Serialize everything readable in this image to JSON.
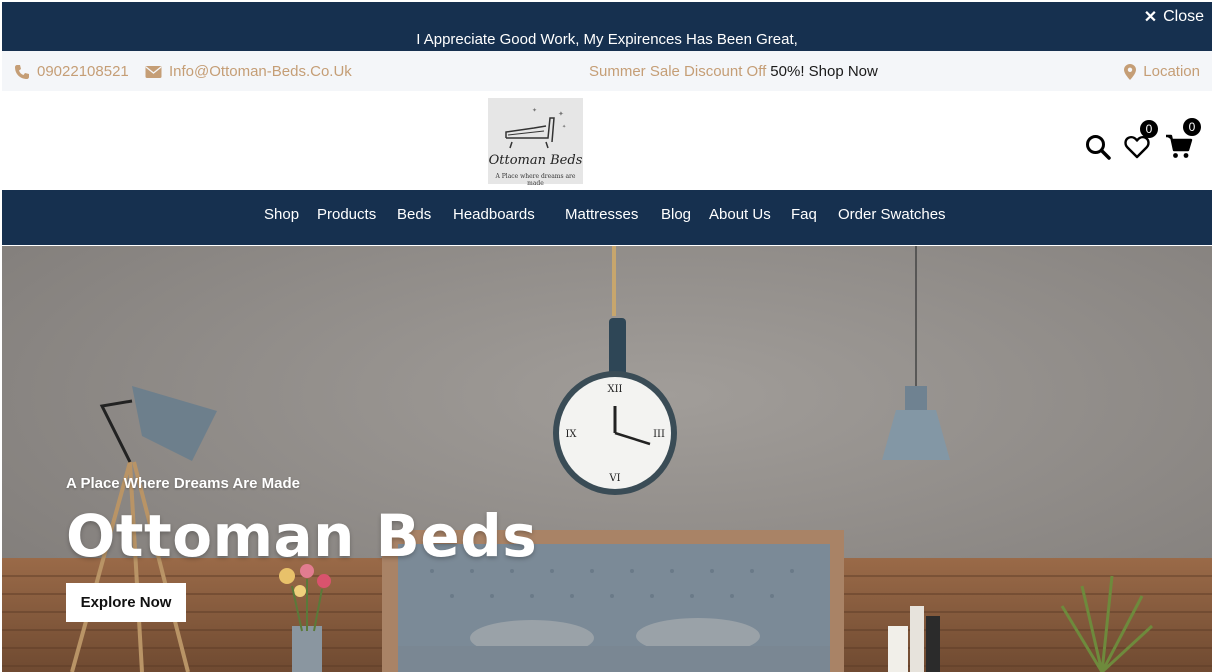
{
  "announcement": {
    "message": "I Appreciate Good Work, My Expirences Has Been Great,",
    "close_label": "Close"
  },
  "infobar": {
    "phone": "09022108521",
    "email": "Info@Ottoman-Beds.Co.Uk",
    "sale_prefix": "Summer Sale Discount Off",
    "sale_highlight": "50%! Shop Now",
    "location": "Location"
  },
  "header": {
    "logo_brand": "Ottoman Beds",
    "logo_tagline": "A Place where dreams are made",
    "wishlist_count": "0",
    "cart_count": "0"
  },
  "nav": {
    "items": [
      "Shop",
      "Products",
      "Beds",
      "Headboards",
      "Mattresses",
      "Blog",
      "About Us",
      "Faq",
      "Order Swatches"
    ]
  },
  "hero": {
    "subtitle": "A Place Where Dreams Are Made",
    "title": "Ottoman Beds",
    "cta": "Explore Now"
  },
  "colors": {
    "navy": "#16304f",
    "accent": "#c59e76",
    "infobar_bg": "#f4f6f9"
  },
  "icons": [
    "close-icon",
    "phone-icon",
    "envelope-icon",
    "map-marker-icon",
    "search-icon",
    "heart-icon",
    "cart-icon"
  ]
}
